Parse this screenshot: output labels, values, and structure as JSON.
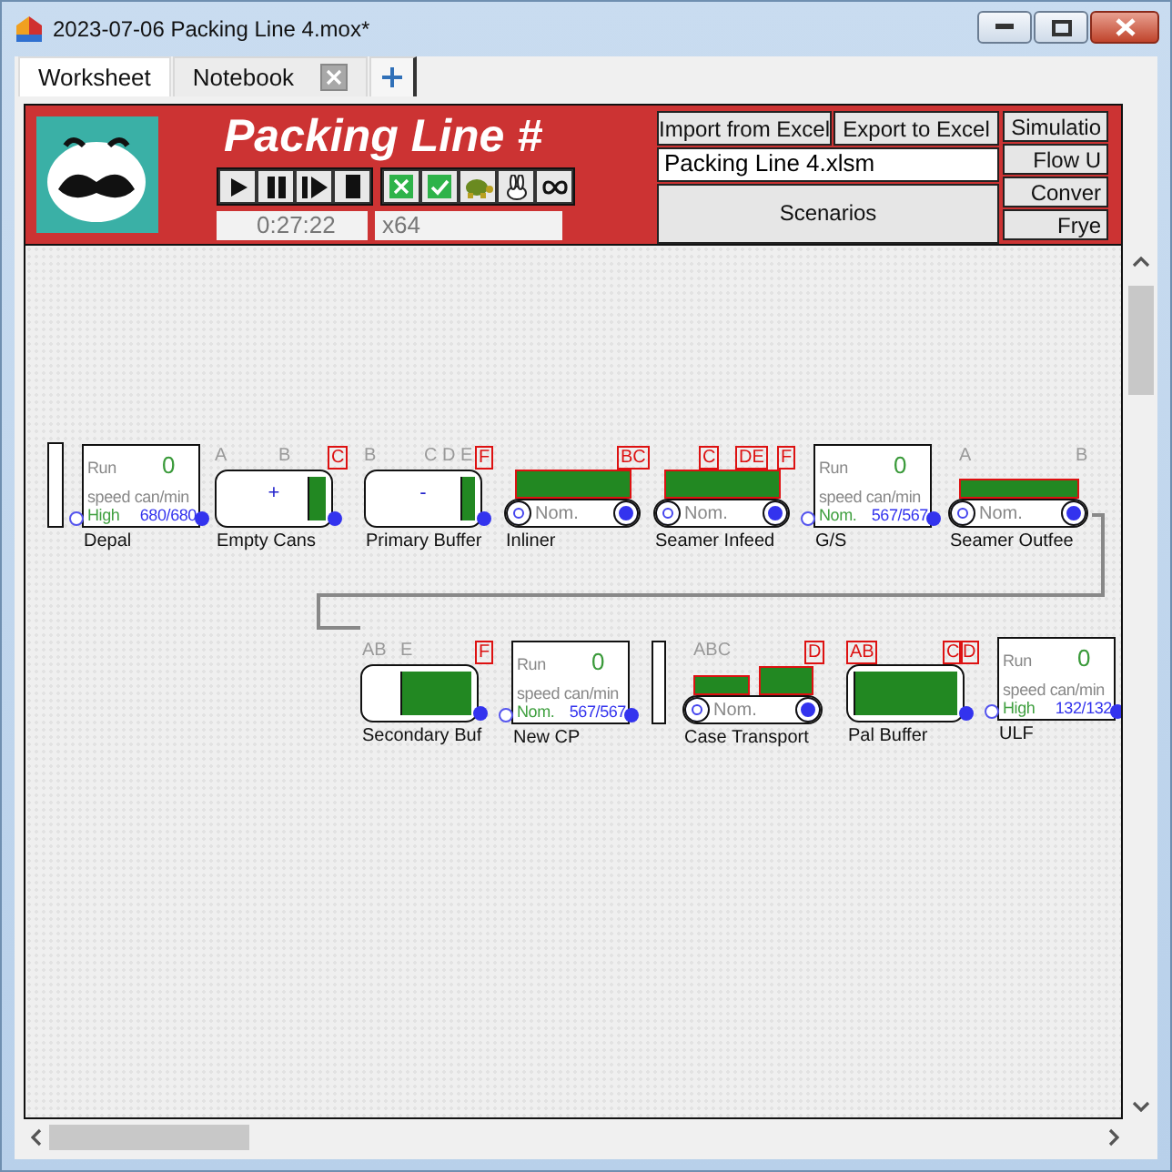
{
  "window": {
    "title": "2023-07-06 Packing Line 4.mox*"
  },
  "tabs": [
    {
      "label": "Worksheet",
      "selected": true,
      "closable": false
    },
    {
      "label": "Notebook",
      "selected": false,
      "closable": true
    }
  ],
  "header": {
    "title": "Packing Line #",
    "time": "0:27:22",
    "speed": "x64",
    "buttons": [
      {
        "label": "Import from Excel"
      },
      {
        "label": "Export to Excel"
      }
    ],
    "file": "Packing Line 4.xlsm",
    "scenarios": "Scenarios",
    "side_buttons": [
      {
        "label": "Simulatio"
      },
      {
        "label": "Flow U"
      },
      {
        "label": "Conver"
      },
      {
        "label": "Frye"
      }
    ]
  },
  "nodes": [
    {
      "kind": "gate"
    },
    {
      "kind": "machine",
      "name": "Depal",
      "status": "Run",
      "count": "0",
      "unit": "speed can/min",
      "mode": "High",
      "rate": "680/680"
    },
    {
      "kind": "buffer",
      "name": "Empty Cans",
      "sign": "+",
      "level": 0.15,
      "tags": [
        {
          "text": "A",
          "alert": false
        },
        {
          "text": "B",
          "alert": false
        },
        {
          "text": "C",
          "alert": true
        }
      ]
    },
    {
      "kind": "buffer",
      "name": "Primary Buffer",
      "sign": "-",
      "level": 0.12,
      "tags": [
        {
          "text": "B",
          "alert": false
        },
        {
          "text": "C D E",
          "alert": false
        },
        {
          "text": "F",
          "alert": true
        }
      ]
    },
    {
      "kind": "conveyor",
      "name": "Inliner",
      "mode": "Nom.",
      "loads": [
        {
          "kind": "tall"
        }
      ],
      "tags": [
        {
          "text": "BC",
          "alert": true
        }
      ]
    },
    {
      "kind": "conveyor",
      "name": "Seamer Infeed",
      "mode": "Nom.",
      "loads": [
        {
          "kind": "tall"
        }
      ],
      "tags": [
        {
          "text": "C",
          "alert": true
        },
        {
          "text": "DE",
          "alert": true
        },
        {
          "text": "F",
          "alert": true
        }
      ]
    },
    {
      "kind": "machine",
      "name": "G/S",
      "status": "Run",
      "count": "0",
      "unit": "speed can/min",
      "mode": "Nom.",
      "rate": "567/567"
    },
    {
      "kind": "conveyor",
      "name": "Seamer Outfee",
      "mode": "Nom.",
      "loads": [
        {
          "kind": "short"
        }
      ],
      "tags": [
        {
          "text": "A",
          "alert": false
        },
        {
          "text": "B",
          "alert": false
        }
      ]
    },
    {
      "kind": "buffer",
      "name": "Secondary Buf",
      "level": 0.66,
      "tags": [
        {
          "text": "AB",
          "alert": false
        },
        {
          "text": "E",
          "alert": false
        },
        {
          "text": "F",
          "alert": true
        }
      ]
    },
    {
      "kind": "machine",
      "name": "New CP",
      "status": "Run",
      "count": "0",
      "unit": "speed can/min",
      "mode": "Nom.",
      "rate": "567/567"
    },
    {
      "kind": "gate"
    },
    {
      "kind": "conveyor",
      "name": "Case Transport",
      "mode": "Nom.",
      "loads": [
        {
          "kind": "short"
        },
        {
          "kind": "tall"
        }
      ],
      "tags": [
        {
          "text": "ABC",
          "alert": false
        },
        {
          "text": "D",
          "alert": true
        }
      ]
    },
    {
      "kind": "buffer",
      "name": "Pal Buffer",
      "level": 1,
      "tags": [
        {
          "text": "AB",
          "alert": true
        },
        {
          "text": "C",
          "alert": true
        },
        {
          "text": "D",
          "alert": true
        }
      ]
    },
    {
      "kind": "machine",
      "name": "ULF",
      "status": "Run",
      "count": "0",
      "unit": "speed can/min",
      "mode": "High",
      "rate": "132/132"
    }
  ]
}
